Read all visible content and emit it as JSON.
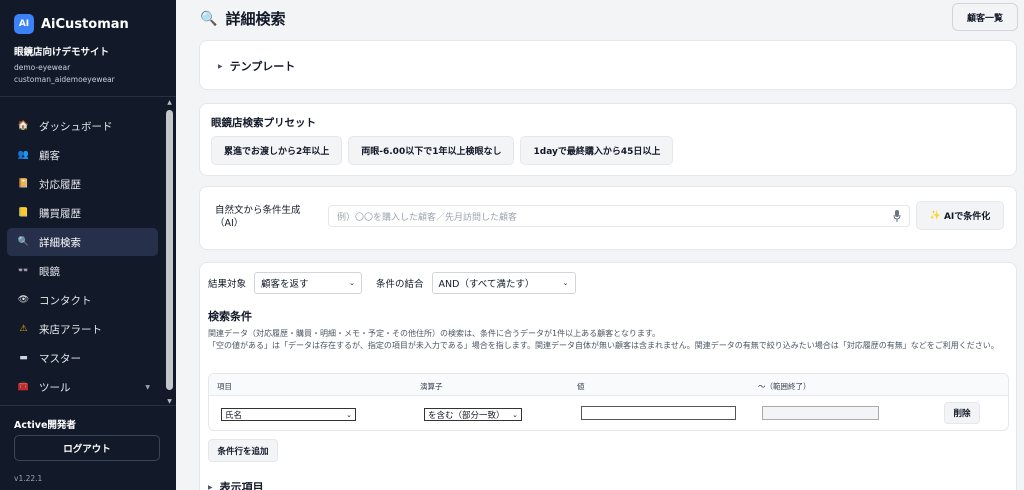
{
  "sidebar": {
    "brand_logo": "AI",
    "brand_name": "AiCustoman",
    "site_name": "眼鏡店向けデモサイト",
    "site_id": "demo-eyewear",
    "account_id": "customan_aidemoeyewear",
    "items": [
      {
        "label": "ダッシュボード",
        "icon": "house-icon"
      },
      {
        "label": "顧客",
        "icon": "users-icon"
      },
      {
        "label": "対応履歴",
        "icon": "notebook-icon"
      },
      {
        "label": "購買履歴",
        "icon": "receipt-icon"
      },
      {
        "label": "詳細検索",
        "icon": "magnifier-icon"
      },
      {
        "label": "眼鏡",
        "icon": "glasses-icon"
      },
      {
        "label": "コンタクト",
        "icon": "eye-icon"
      },
      {
        "label": "来店アラート",
        "icon": "warning-icon"
      },
      {
        "label": "マスター",
        "icon": "folder-icon"
      },
      {
        "label": "ツール",
        "icon": "toolbox-icon"
      }
    ],
    "active_index": 4,
    "user_name": "Active開発者",
    "logout_label": "ログアウト",
    "version": "v1.22.1"
  },
  "header": {
    "title": "詳細検索",
    "customer_list_label": "顧客一覧"
  },
  "template_section": {
    "label": "テンプレート"
  },
  "presets": {
    "title": "眼鏡店検索プリセット",
    "buttons": [
      "累進でお渡しから2年以上",
      "両眼-6.00以下で1年以上検眼なし",
      "1dayで最終購入から45日以上"
    ]
  },
  "natural_language": {
    "label_line1": "自然文から条件生成",
    "label_line2": "（AI）",
    "placeholder": "例）〇〇を購入した顧客／先月訪問した顧客",
    "ai_button_icon": "✨",
    "ai_button_label": "AIで条件化"
  },
  "search": {
    "target_label": "結果対象",
    "target_value": "顧客を返す",
    "combine_label": "条件の結合",
    "combine_value": "AND（すべて満たす）",
    "conditions_title": "検索条件",
    "help_line1": "関連データ（対応履歴・購買・明細・メモ・予定・その他住所）の検索は、条件に合うデータが1件以上ある顧客となります。",
    "help_line2": "「空の値がある」は「データは存在するが、指定の項目が未入力である」場合を指します。関連データ自体が無い顧客は含まれません。関連データの有無で絞り込みたい場合は「対応履歴の有無」などをご利用ください。",
    "columns": [
      "項目",
      "演算子",
      "値",
      "〜（範囲終了）"
    ],
    "row": {
      "field": "氏名",
      "operator": "を含む（部分一致）",
      "value": "",
      "range_end": "",
      "delete_label": "削除"
    },
    "add_row_label": "条件行を追加",
    "display_items_label": "表示項目"
  }
}
